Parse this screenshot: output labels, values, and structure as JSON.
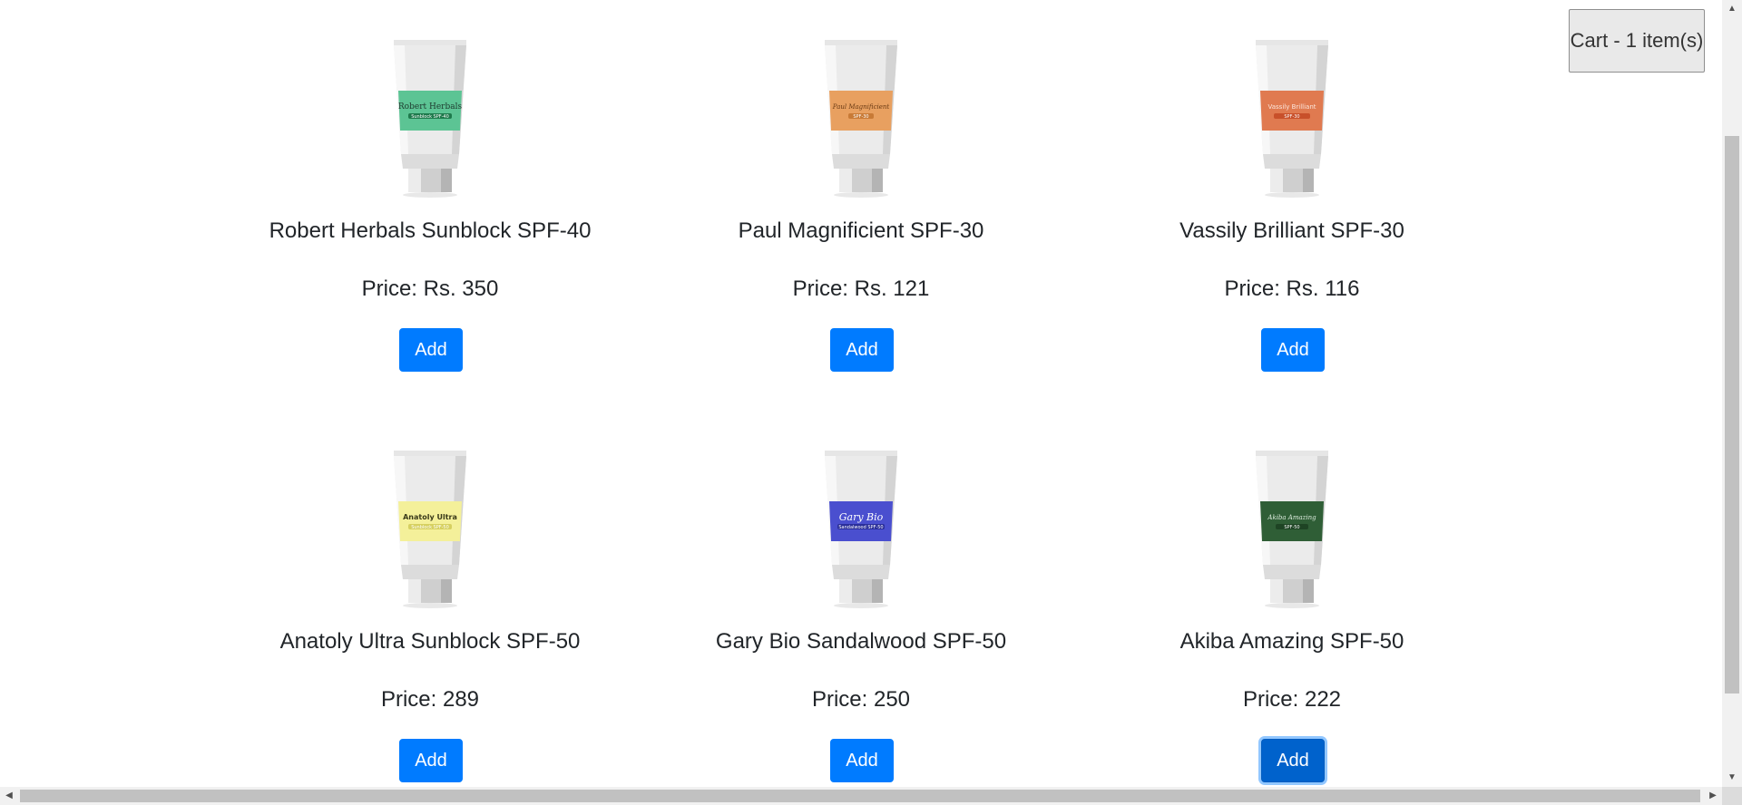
{
  "cart": {
    "label": "Cart - 1 item(s)"
  },
  "products": [
    {
      "name": "Robert Herbals Sunblock SPF-40",
      "price": "Price: Rs. 350",
      "button": "Add",
      "label_color": "#5cc494",
      "label_band_color": "#1e7a4c",
      "tube_brand": "Robert Herbals",
      "tube_sub": "Sunblock SPF-40"
    },
    {
      "name": "Paul Magnificient SPF-30",
      "price": "Price: Rs. 121",
      "button": "Add",
      "label_color": "#e8a060",
      "label_band_color": "#c87a36",
      "tube_brand": "Paul Magnificient",
      "tube_sub": "SPF-30"
    },
    {
      "name": "Vassily Brilliant SPF-30",
      "price": "Price: Rs. 116",
      "button": "Add",
      "label_color": "#e07a50",
      "label_band_color": "#c8502a",
      "tube_brand": "Vassily Brilliant",
      "tube_sub": "SPF-30"
    },
    {
      "name": "Anatoly Ultra Sunblock SPF-50",
      "price": "Price: 289",
      "button": "Add",
      "label_color": "#f4f09a",
      "label_band_color": "#d6d060",
      "tube_brand": "Anatoly Ultra",
      "tube_sub": "Sunblock SPF-50"
    },
    {
      "name": "Gary Bio Sandalwood SPF-50",
      "price": "Price: 250",
      "button": "Add",
      "label_color": "#4a4fcf",
      "label_band_color": "#2a2e9a",
      "tube_brand": "Gary Bio",
      "tube_sub": "Sandalwood SPF-50"
    },
    {
      "name": "Akiba Amazing SPF-50",
      "price": "Price: 222",
      "button": "Add",
      "label_color": "#2f5e36",
      "label_band_color": "#1e4424",
      "tube_brand": "Akiba Amazing",
      "tube_sub": "SPF-50"
    }
  ],
  "colors": {
    "primary": "#007bff",
    "primary_focused": "#0062cc"
  },
  "icons": {
    "scroll_up": "triangle-up-icon",
    "scroll_down": "triangle-down-icon",
    "scroll_left": "triangle-left-icon",
    "scroll_right": "triangle-right-icon"
  }
}
